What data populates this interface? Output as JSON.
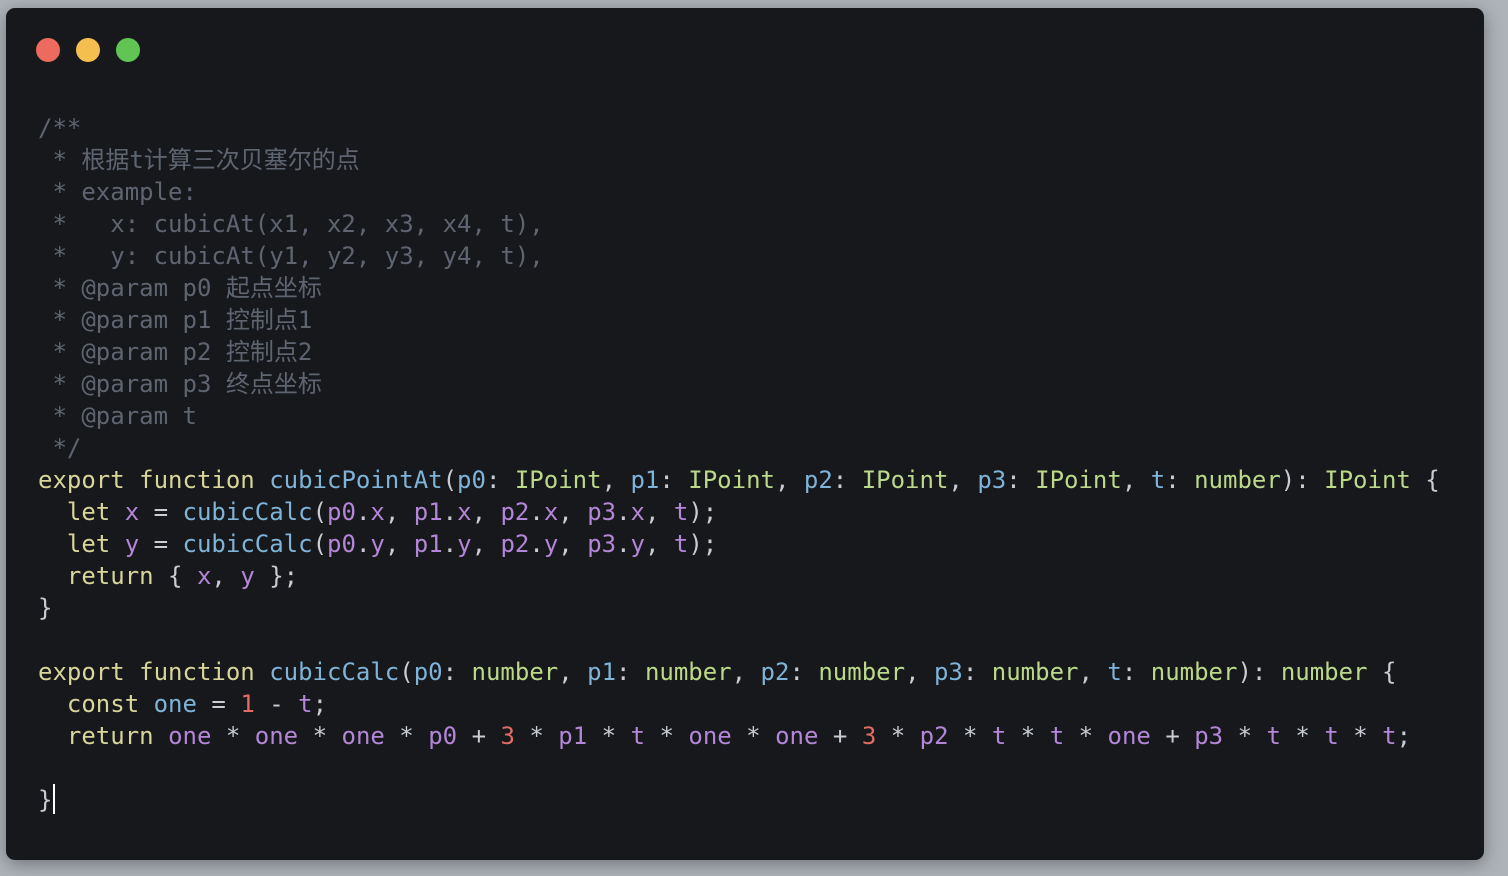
{
  "window": {
    "controls": [
      "close",
      "minimize",
      "zoom"
    ],
    "colors": {
      "background": "#16181b",
      "close": "#ec6a5e",
      "minimize": "#f4bf4f",
      "zoom": "#61c554"
    }
  },
  "code": {
    "lines": [
      [
        {
          "t": "/**",
          "c": "comment"
        }
      ],
      [
        {
          "t": " * 根据t计算三次贝塞尔的点",
          "c": "comment"
        }
      ],
      [
        {
          "t": " * example:",
          "c": "comment"
        }
      ],
      [
        {
          "t": " *   x: cubicAt(x1, x2, x3, x4, t),",
          "c": "comment"
        }
      ],
      [
        {
          "t": " *   y: cubicAt(y1, y2, y3, y4, t),",
          "c": "comment"
        }
      ],
      [
        {
          "t": " * @param p0 起点坐标",
          "c": "comment"
        }
      ],
      [
        {
          "t": " * @param p1 控制点1",
          "c": "comment"
        }
      ],
      [
        {
          "t": " * @param p2 控制点2",
          "c": "comment"
        }
      ],
      [
        {
          "t": " * @param p3 终点坐标",
          "c": "comment"
        }
      ],
      [
        {
          "t": " * @param t",
          "c": "comment"
        }
      ],
      [
        {
          "t": " */",
          "c": "comment"
        }
      ],
      [
        {
          "t": "export",
          "c": "kw"
        },
        {
          "t": " ",
          "c": "punc"
        },
        {
          "t": "function",
          "c": "kw"
        },
        {
          "t": " ",
          "c": "punc"
        },
        {
          "t": "cubicPointAt",
          "c": "fn"
        },
        {
          "t": "(",
          "c": "punc"
        },
        {
          "t": "p0",
          "c": "param"
        },
        {
          "t": ": ",
          "c": "punc"
        },
        {
          "t": "IPoint",
          "c": "type"
        },
        {
          "t": ", ",
          "c": "punc"
        },
        {
          "t": "p1",
          "c": "param"
        },
        {
          "t": ": ",
          "c": "punc"
        },
        {
          "t": "IPoint",
          "c": "type"
        },
        {
          "t": ", ",
          "c": "punc"
        },
        {
          "t": "p2",
          "c": "param"
        },
        {
          "t": ": ",
          "c": "punc"
        },
        {
          "t": "IPoint",
          "c": "type"
        },
        {
          "t": ", ",
          "c": "punc"
        },
        {
          "t": "p3",
          "c": "param"
        },
        {
          "t": ": ",
          "c": "punc"
        },
        {
          "t": "IPoint",
          "c": "type"
        },
        {
          "t": ", ",
          "c": "punc"
        },
        {
          "t": "t",
          "c": "param"
        },
        {
          "t": ": ",
          "c": "punc"
        },
        {
          "t": "number",
          "c": "type"
        },
        {
          "t": "): ",
          "c": "punc"
        },
        {
          "t": "IPoint",
          "c": "type"
        },
        {
          "t": " {",
          "c": "punc"
        }
      ],
      [
        {
          "t": "  ",
          "c": "punc"
        },
        {
          "t": "let",
          "c": "kw"
        },
        {
          "t": " ",
          "c": "punc"
        },
        {
          "t": "x",
          "c": "var"
        },
        {
          "t": " = ",
          "c": "punc"
        },
        {
          "t": "cubicCalc",
          "c": "fn"
        },
        {
          "t": "(",
          "c": "punc"
        },
        {
          "t": "p0",
          "c": "var"
        },
        {
          "t": ".",
          "c": "punc"
        },
        {
          "t": "x",
          "c": "var"
        },
        {
          "t": ", ",
          "c": "punc"
        },
        {
          "t": "p1",
          "c": "var"
        },
        {
          "t": ".",
          "c": "punc"
        },
        {
          "t": "x",
          "c": "var"
        },
        {
          "t": ", ",
          "c": "punc"
        },
        {
          "t": "p2",
          "c": "var"
        },
        {
          "t": ".",
          "c": "punc"
        },
        {
          "t": "x",
          "c": "var"
        },
        {
          "t": ", ",
          "c": "punc"
        },
        {
          "t": "p3",
          "c": "var"
        },
        {
          "t": ".",
          "c": "punc"
        },
        {
          "t": "x",
          "c": "var"
        },
        {
          "t": ", ",
          "c": "punc"
        },
        {
          "t": "t",
          "c": "var"
        },
        {
          "t": ");",
          "c": "punc"
        }
      ],
      [
        {
          "t": "  ",
          "c": "punc"
        },
        {
          "t": "let",
          "c": "kw"
        },
        {
          "t": " ",
          "c": "punc"
        },
        {
          "t": "y",
          "c": "var"
        },
        {
          "t": " = ",
          "c": "punc"
        },
        {
          "t": "cubicCalc",
          "c": "fn"
        },
        {
          "t": "(",
          "c": "punc"
        },
        {
          "t": "p0",
          "c": "var"
        },
        {
          "t": ".",
          "c": "punc"
        },
        {
          "t": "y",
          "c": "var"
        },
        {
          "t": ", ",
          "c": "punc"
        },
        {
          "t": "p1",
          "c": "var"
        },
        {
          "t": ".",
          "c": "punc"
        },
        {
          "t": "y",
          "c": "var"
        },
        {
          "t": ", ",
          "c": "punc"
        },
        {
          "t": "p2",
          "c": "var"
        },
        {
          "t": ".",
          "c": "punc"
        },
        {
          "t": "y",
          "c": "var"
        },
        {
          "t": ", ",
          "c": "punc"
        },
        {
          "t": "p3",
          "c": "var"
        },
        {
          "t": ".",
          "c": "punc"
        },
        {
          "t": "y",
          "c": "var"
        },
        {
          "t": ", ",
          "c": "punc"
        },
        {
          "t": "t",
          "c": "var"
        },
        {
          "t": ");",
          "c": "punc"
        }
      ],
      [
        {
          "t": "  ",
          "c": "punc"
        },
        {
          "t": "return",
          "c": "kw"
        },
        {
          "t": " { ",
          "c": "punc"
        },
        {
          "t": "x",
          "c": "var"
        },
        {
          "t": ", ",
          "c": "punc"
        },
        {
          "t": "y",
          "c": "var"
        },
        {
          "t": " };",
          "c": "punc"
        }
      ],
      [
        {
          "t": "}",
          "c": "punc"
        }
      ],
      [],
      [
        {
          "t": "export",
          "c": "kw"
        },
        {
          "t": " ",
          "c": "punc"
        },
        {
          "t": "function",
          "c": "kw"
        },
        {
          "t": " ",
          "c": "punc"
        },
        {
          "t": "cubicCalc",
          "c": "fn"
        },
        {
          "t": "(",
          "c": "punc"
        },
        {
          "t": "p0",
          "c": "param"
        },
        {
          "t": ": ",
          "c": "punc"
        },
        {
          "t": "number",
          "c": "type"
        },
        {
          "t": ", ",
          "c": "punc"
        },
        {
          "t": "p1",
          "c": "param"
        },
        {
          "t": ": ",
          "c": "punc"
        },
        {
          "t": "number",
          "c": "type"
        },
        {
          "t": ", ",
          "c": "punc"
        },
        {
          "t": "p2",
          "c": "param"
        },
        {
          "t": ": ",
          "c": "punc"
        },
        {
          "t": "number",
          "c": "type"
        },
        {
          "t": ", ",
          "c": "punc"
        },
        {
          "t": "p3",
          "c": "param"
        },
        {
          "t": ": ",
          "c": "punc"
        },
        {
          "t": "number",
          "c": "type"
        },
        {
          "t": ", ",
          "c": "punc"
        },
        {
          "t": "t",
          "c": "param"
        },
        {
          "t": ": ",
          "c": "punc"
        },
        {
          "t": "number",
          "c": "type"
        },
        {
          "t": "): ",
          "c": "punc"
        },
        {
          "t": "number",
          "c": "type"
        },
        {
          "t": " {",
          "c": "punc"
        }
      ],
      [
        {
          "t": "  ",
          "c": "punc"
        },
        {
          "t": "const",
          "c": "kw"
        },
        {
          "t": " ",
          "c": "punc"
        },
        {
          "t": "one",
          "c": "param"
        },
        {
          "t": " = ",
          "c": "punc"
        },
        {
          "t": "1",
          "c": "num"
        },
        {
          "t": " - ",
          "c": "punc"
        },
        {
          "t": "t",
          "c": "var"
        },
        {
          "t": ";",
          "c": "punc"
        }
      ],
      [
        {
          "t": "  ",
          "c": "punc"
        },
        {
          "t": "return",
          "c": "kw"
        },
        {
          "t": " ",
          "c": "punc"
        },
        {
          "t": "one",
          "c": "var"
        },
        {
          "t": " * ",
          "c": "punc"
        },
        {
          "t": "one",
          "c": "var"
        },
        {
          "t": " * ",
          "c": "punc"
        },
        {
          "t": "one",
          "c": "var"
        },
        {
          "t": " * ",
          "c": "punc"
        },
        {
          "t": "p0",
          "c": "var"
        },
        {
          "t": " + ",
          "c": "punc"
        },
        {
          "t": "3",
          "c": "num"
        },
        {
          "t": " * ",
          "c": "punc"
        },
        {
          "t": "p1",
          "c": "var"
        },
        {
          "t": " * ",
          "c": "punc"
        },
        {
          "t": "t",
          "c": "var"
        },
        {
          "t": " * ",
          "c": "punc"
        },
        {
          "t": "one",
          "c": "var"
        },
        {
          "t": " * ",
          "c": "punc"
        },
        {
          "t": "one",
          "c": "var"
        },
        {
          "t": " + ",
          "c": "punc"
        },
        {
          "t": "3",
          "c": "num"
        },
        {
          "t": " * ",
          "c": "punc"
        },
        {
          "t": "p2",
          "c": "var"
        },
        {
          "t": " * ",
          "c": "punc"
        },
        {
          "t": "t",
          "c": "var"
        },
        {
          "t": " * ",
          "c": "punc"
        },
        {
          "t": "t",
          "c": "var"
        },
        {
          "t": " * ",
          "c": "punc"
        },
        {
          "t": "one",
          "c": "var"
        },
        {
          "t": " + ",
          "c": "punc"
        },
        {
          "t": "p3",
          "c": "var"
        },
        {
          "t": " * ",
          "c": "punc"
        },
        {
          "t": "t",
          "c": "var"
        },
        {
          "t": " * ",
          "c": "punc"
        },
        {
          "t": "t",
          "c": "var"
        },
        {
          "t": " * ",
          "c": "punc"
        },
        {
          "t": "t",
          "c": "var"
        },
        {
          "t": ";",
          "c": "punc"
        }
      ],
      [],
      [
        {
          "t": "}",
          "c": "punc"
        }
      ]
    ],
    "cursor_line": 21
  }
}
